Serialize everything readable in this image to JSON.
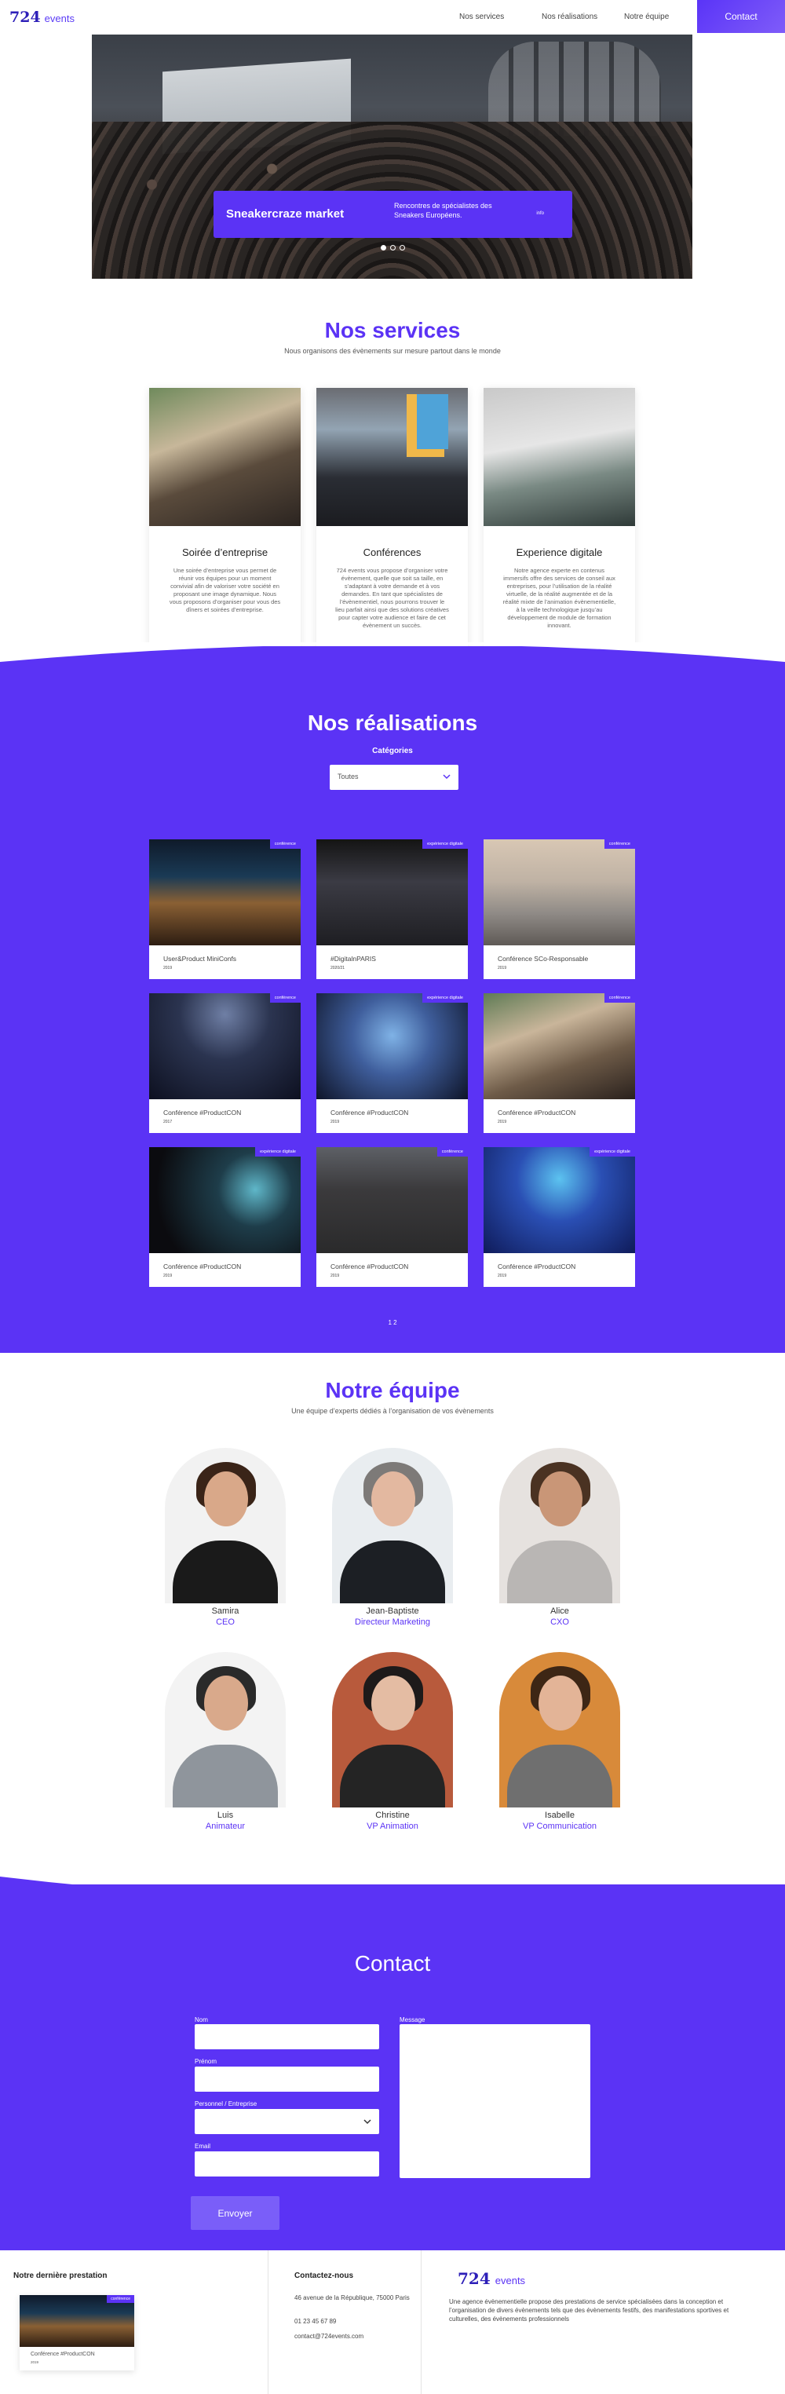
{
  "nav": {
    "logo_number": "724",
    "logo_text": "events",
    "links": [
      "Nos services",
      "Nos réalisations",
      "Notre équipe"
    ],
    "contact": "Contact"
  },
  "hero": {
    "title": "Sneakercraze market",
    "description": "Rencontres de spécialistes des Sneakers Européens.",
    "more": "info",
    "dots": 3,
    "active_dot": 0
  },
  "services": {
    "title": "Nos services",
    "subtitle": "Nous organisons des évènements sur mesure partout dans le monde",
    "items": [
      {
        "title": "Soirée d’entreprise",
        "text": "Une soirée d’entreprise vous permet de réunir vos équipes pour un moment convivial afin de valoriser votre société en proposant une image dynamique. Nous vous proposons d’organiser pour vous des dîners et soirées d’entreprise."
      },
      {
        "title": "Conférences",
        "text": "724 events vous propose d’organiser votre évènement, quelle que soit sa taille, en s’adaptant à votre demande et à vos demandes. En tant que spécialistes de l’évènementiel, nous pourrons trouver le lieu parfait ainsi que des solutions créatives pour capter votre audience et faire de cet évènement un succès."
      },
      {
        "title": "Experience digitale",
        "text": "Notre agence experte en contenus immersifs offre des services de conseil aux entreprises, pour l’utilisation de la réalité virtuelle, de la réalité augmentée et de la réalité mixte de l’animation évènementielle, à la veille technologique jusqu’au développement de module de formation innovant."
      }
    ]
  },
  "realisations": {
    "title": "Nos réalisations",
    "category_label": "Catégories",
    "category_value": "Toutes",
    "items": [
      {
        "title": "User&Product MiniConfs",
        "year": "2019",
        "tag": "conférence"
      },
      {
        "title": "#DigitalnPARIS",
        "year": "2020/21",
        "tag": "expérience digitale"
      },
      {
        "title": "Conférence SCo-Responsable",
        "year": "2019",
        "tag": "conférence"
      },
      {
        "title": "Conférence #ProductCON",
        "year": "2017",
        "tag": "conférence"
      },
      {
        "title": "Conférence #ProductCON",
        "year": "2019",
        "tag": "expérience digitale"
      },
      {
        "title": "Conférence #ProductCON",
        "year": "2019",
        "tag": "conférence"
      },
      {
        "title": "Conférence #ProductCON",
        "year": "2019",
        "tag": "expérience digitale"
      },
      {
        "title": "Conférence #ProductCON",
        "year": "2019",
        "tag": "conférence"
      },
      {
        "title": "Conférence #ProductCON",
        "year": "2019",
        "tag": "expérience digitale"
      }
    ],
    "pager": "1 2"
  },
  "team": {
    "title": "Notre équipe",
    "subtitle": "Une équipe d’experts dédiés à l’organisation de vos évènements",
    "members": [
      {
        "name": "Samira",
        "role": "CEO"
      },
      {
        "name": "Jean-Baptiste",
        "role": "Directeur Marketing"
      },
      {
        "name": "Alice",
        "role": "CXO"
      },
      {
        "name": "Luis",
        "role": "Animateur"
      },
      {
        "name": "Christine",
        "role": "VP Animation"
      },
      {
        "name": "Isabelle",
        "role": "VP Communication"
      }
    ]
  },
  "contact": {
    "title": "Contact",
    "fields": {
      "nom": "Nom",
      "prenom": "Prénom",
      "type": "Personnel / Entreprise",
      "email": "Email",
      "message": "Message"
    },
    "send": "Envoyer"
  },
  "footer": {
    "last_title": "Notre dernière prestation",
    "last_item": {
      "title": "Conférence #ProductCON",
      "year": "2019",
      "tag": "conférence"
    },
    "contact_title": "Contactez-nous",
    "address": "46 avenue de la République, 75000 Paris",
    "phone": "01 23 45 67 89",
    "email": "contact@724events.com",
    "social": [
      "twitch-icon",
      "facebook-icon",
      "twitter-icon",
      "youtube-icon"
    ],
    "logo_number": "724",
    "logo_text": "events",
    "about": "Une agence évènementielle propose des prestations de service spécialisées dans la conception et l’organisation de divers évènements tels que des évènements festifs, des manifestations sportives et culturelles, des évènements professionnels"
  },
  "colors": {
    "brand": "#5b33f5",
    "brand_dark": "#2d1fb8"
  }
}
